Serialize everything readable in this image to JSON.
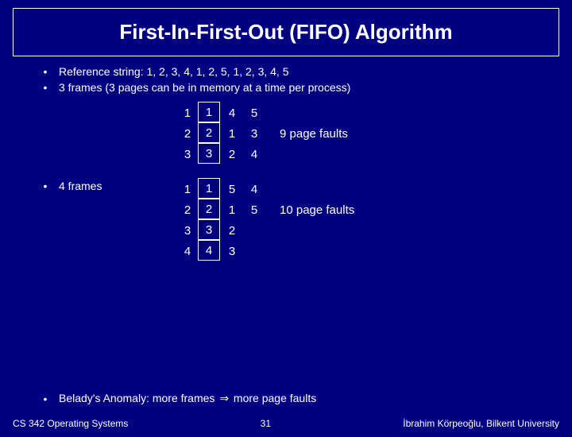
{
  "title": "First-In-First-Out (FIFO) Algorithm",
  "bullets": {
    "ref": "Reference string: 1, 2, 3, 4, 1, 2, 5, 1, 2, 3, 4, 5",
    "three": "3 frames (3 pages can be in memory at a time per process)",
    "four": "4 frames",
    "belady_a": "Belady's Anomaly: more frames ",
    "belady_b": " more page faults"
  },
  "table3": {
    "r0": {
      "c0": "1",
      "c1": "1",
      "c2": "4",
      "c3": "5",
      "ann": ""
    },
    "r1": {
      "c0": "2",
      "c1": "2",
      "c2": "1",
      "c3": "3",
      "ann": "9 page faults"
    },
    "r2": {
      "c0": "3",
      "c1": "3",
      "c2": "2",
      "c3": "4",
      "ann": ""
    }
  },
  "table4": {
    "r0": {
      "c0": "1",
      "c1": "1",
      "c2": "5",
      "c3": "4",
      "ann": ""
    },
    "r1": {
      "c0": "2",
      "c1": "2",
      "c2": "1",
      "c3": "5",
      "ann": "10 page faults"
    },
    "r2": {
      "c0": "3",
      "c1": "3",
      "c2": "2",
      "c3": "",
      "ann": ""
    },
    "r3": {
      "c0": "4",
      "c1": "4",
      "c2": "3",
      "c3": "",
      "ann": ""
    }
  },
  "footer": {
    "left": "CS 342 Operating Systems",
    "page": "31",
    "right": "İbrahim Körpeoğlu, Bilkent University"
  },
  "glyph": {
    "implies": "⇒"
  }
}
